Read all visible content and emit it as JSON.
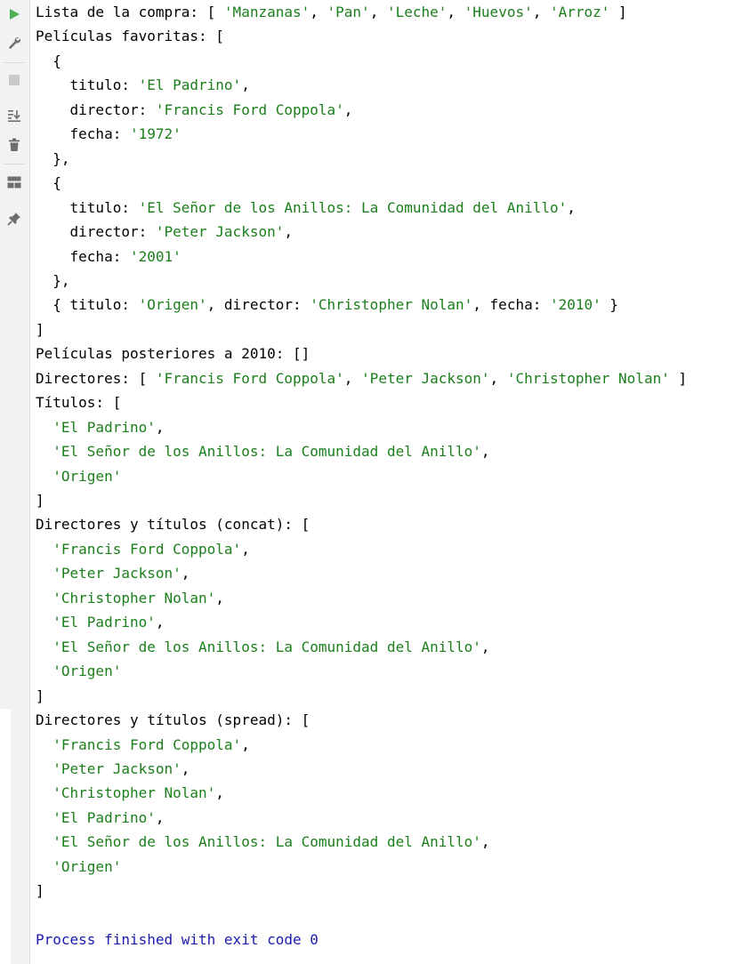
{
  "toolbar": {
    "icons": [
      "run-icon",
      "wrench-icon",
      "stop-icon",
      "scroll-to-end-icon",
      "clear-icon",
      "layout-icon",
      "pin-icon"
    ],
    "colors": {
      "run": "#4caf50",
      "icon": "#6e6e6e",
      "disabled": "#c9c9c9"
    }
  },
  "console": {
    "colors": {
      "text": "#000000",
      "string": "#1b7f1b",
      "exit": "#1a1ab0"
    },
    "lines": [
      [
        "Lista de la compra: [ ",
        "'Manzanas'",
        ", ",
        "'Pan'",
        ", ",
        "'Leche'",
        ", ",
        "'Huevos'",
        ", ",
        "'Arroz'",
        " ]"
      ],
      [
        "Películas favoritas: ["
      ],
      [
        "  {"
      ],
      [
        "    titulo: ",
        "'El Padrino'",
        ","
      ],
      [
        "    director: ",
        "'Francis Ford Coppola'",
        ","
      ],
      [
        "    fecha: ",
        "'1972'"
      ],
      [
        "  },"
      ],
      [
        "  {"
      ],
      [
        "    titulo: ",
        "'El Señor de los Anillos: La Comunidad del Anillo'",
        ","
      ],
      [
        "    director: ",
        "'Peter Jackson'",
        ","
      ],
      [
        "    fecha: ",
        "'2001'"
      ],
      [
        "  },"
      ],
      [
        "  { titulo: ",
        "'Origen'",
        ", director: ",
        "'Christopher Nolan'",
        ", fecha: ",
        "'2010'",
        " }"
      ],
      [
        "]"
      ],
      [
        "Películas posteriores a 2010: []"
      ],
      [
        "Directores: [ ",
        "'Francis Ford Coppola'",
        ", ",
        "'Peter Jackson'",
        ", ",
        "'Christopher Nolan'",
        " ]"
      ],
      [
        "Títulos: ["
      ],
      [
        "  ",
        "'El Padrino'",
        ","
      ],
      [
        "  ",
        "'El Señor de los Anillos: La Comunidad del Anillo'",
        ","
      ],
      [
        "  ",
        "'Origen'"
      ],
      [
        "]"
      ],
      [
        "Directores y títulos (concat): ["
      ],
      [
        "  ",
        "'Francis Ford Coppola'",
        ","
      ],
      [
        "  ",
        "'Peter Jackson'",
        ","
      ],
      [
        "  ",
        "'Christopher Nolan'",
        ","
      ],
      [
        "  ",
        "'El Padrino'",
        ","
      ],
      [
        "  ",
        "'El Señor de los Anillos: La Comunidad del Anillo'",
        ","
      ],
      [
        "  ",
        "'Origen'"
      ],
      [
        "]"
      ],
      [
        "Directores y títulos (spread): ["
      ],
      [
        "  ",
        "'Francis Ford Coppola'",
        ","
      ],
      [
        "  ",
        "'Peter Jackson'",
        ","
      ],
      [
        "  ",
        "'Christopher Nolan'",
        ","
      ],
      [
        "  ",
        "'El Padrino'",
        ","
      ],
      [
        "  ",
        "'El Señor de los Anillos: La Comunidad del Anillo'",
        ","
      ],
      [
        "  ",
        "'Origen'"
      ],
      [
        "]"
      ],
      [
        ""
      ],
      [
        "Process finished with exit code 0"
      ]
    ]
  }
}
